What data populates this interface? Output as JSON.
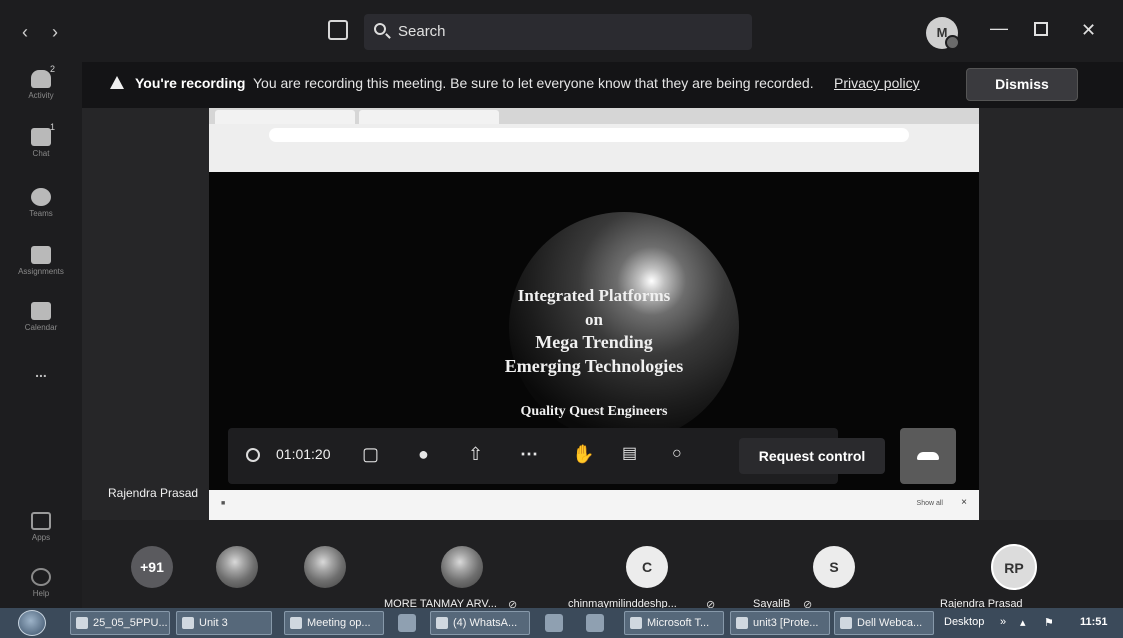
{
  "topbar": {
    "back_icon": "chevron-left-icon",
    "forward_icon": "chevron-right-icon",
    "search_placeholder": "Search",
    "avatar_initial": "M",
    "window_controls": [
      "minimize-icon",
      "maximize-icon",
      "close-icon"
    ]
  },
  "rail": {
    "items": [
      {
        "label": "Activity",
        "badge": "2",
        "icon": "bell-icon"
      },
      {
        "label": "Chat",
        "badge": "1",
        "icon": "chat-icon"
      },
      {
        "label": "Teams",
        "badge": "",
        "icon": "teams-icon"
      },
      {
        "label": "Assignments",
        "badge": "",
        "icon": "assignments-icon"
      },
      {
        "label": "Calendar",
        "badge": "",
        "icon": "calendar-icon"
      },
      {
        "label": "...",
        "badge": "",
        "icon": "more-icon"
      },
      {
        "label": "Apps",
        "badge": "",
        "icon": "apps-icon"
      },
      {
        "label": "Help",
        "badge": "",
        "icon": "help-icon"
      }
    ]
  },
  "banner": {
    "title": "You're recording",
    "message": "You are recording this meeting. Be sure to let everyone know that they are being recorded.",
    "link": "Privacy policy",
    "dismiss": "Dismiss"
  },
  "shared_screen": {
    "slide": {
      "line1": "Integrated Platforms",
      "line2": "on",
      "line3": "Mega Trending",
      "line4": "Emerging Technologies",
      "line5": "Quality Quest Engineers"
    },
    "show_all": "Show all"
  },
  "controls": {
    "timer": "01:01:20",
    "request_control": "Request control"
  },
  "presenter_name": "Rajendra Prasad",
  "participants": [
    {
      "avatar": "+91",
      "name": ""
    },
    {
      "avatar": "",
      "name": ""
    },
    {
      "avatar": "",
      "name": ""
    },
    {
      "avatar": "",
      "name": "MORE TANMAY ARV..."
    },
    {
      "avatar": "C",
      "name": "chinmaymilinddeshp..."
    },
    {
      "avatar": "S",
      "name": "SayaliB"
    },
    {
      "avatar": "RP",
      "name": "Rajendra Prasad"
    }
  ],
  "taskbar": {
    "buttons": [
      "25_05_5PPU...",
      "Unit 3",
      "Meeting op...",
      "(4) WhatsA...",
      "Microsoft T...",
      "unit3 [Prote...",
      "Dell Webca..."
    ],
    "desktop": "Desktop",
    "time": "11:51"
  },
  "colors": {
    "app_background": "#2a2a2a",
    "banner_background": "#141416",
    "taskbar_background": "#3b4a5a"
  }
}
